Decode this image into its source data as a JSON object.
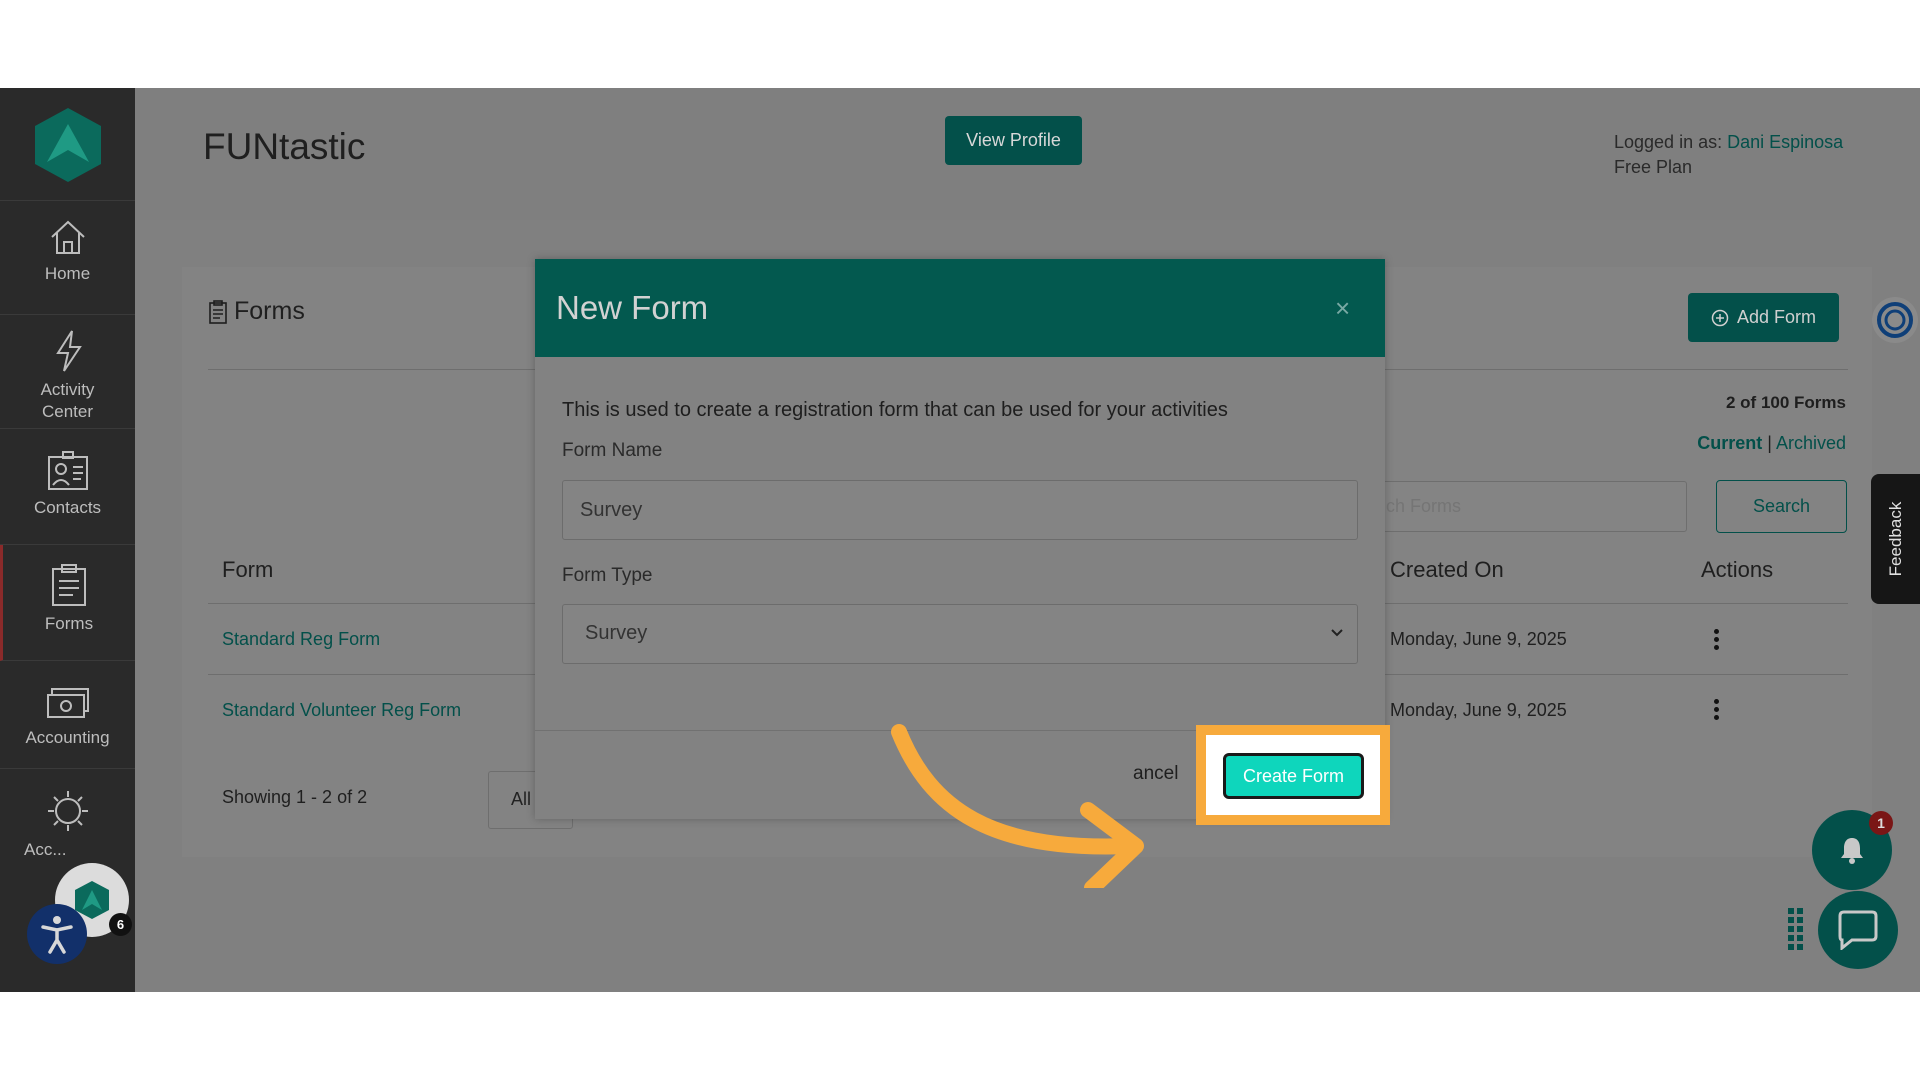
{
  "app": {
    "brand": "FUNtastic",
    "view_profile_label": "View Profile",
    "logged_in_prefix": "Logged in as:",
    "user_name": "Dani Espinosa",
    "plan": "Free Plan"
  },
  "sidebar": {
    "items": [
      {
        "label": "Home",
        "icon": "home-icon"
      },
      {
        "label": "Activity\nCenter",
        "icon": "lightning-icon"
      },
      {
        "label": "Contacts",
        "icon": "contacts-icon"
      },
      {
        "label": "Forms",
        "icon": "forms-icon",
        "active": true
      },
      {
        "label": "Accounting",
        "icon": "money-icon"
      },
      {
        "label": "Acc...",
        "icon": "gear-icon"
      }
    ],
    "mini_badge": "6"
  },
  "forms_page": {
    "title": "Forms",
    "add_form_label": "Add Form",
    "count_text": "2 of 100 Forms",
    "filter_current": "Current",
    "filter_sep": "|",
    "filter_archived": "Archived",
    "search_placeholder": "ch Forms",
    "search_button": "Search",
    "columns": [
      "Form",
      "Created On",
      "Actions"
    ],
    "rows": [
      {
        "name": "Standard Reg Form",
        "created": "Monday, June 9, 2025"
      },
      {
        "name": "Standard Volunteer Reg Form",
        "created": "Monday, June 9, 2025"
      }
    ],
    "showing": "Showing 1 - 2 of 2",
    "page_size": "All"
  },
  "modal": {
    "title": "New Form",
    "close_symbol": "×",
    "description": "This is used to create a registration form that can be used for your activities",
    "form_name_label": "Form Name",
    "form_name_value": "Survey",
    "form_type_label": "Form Type",
    "form_type_value": "Survey",
    "cancel_label": "ancel",
    "create_label": "Create Form"
  },
  "widgets": {
    "feedback_label": "Feedback",
    "bell_badge": "1"
  },
  "colors": {
    "accent": "#03504a",
    "modal_header": "#03594f",
    "highlight": "#f7aa3c",
    "create_button": "#0ed6bc"
  }
}
